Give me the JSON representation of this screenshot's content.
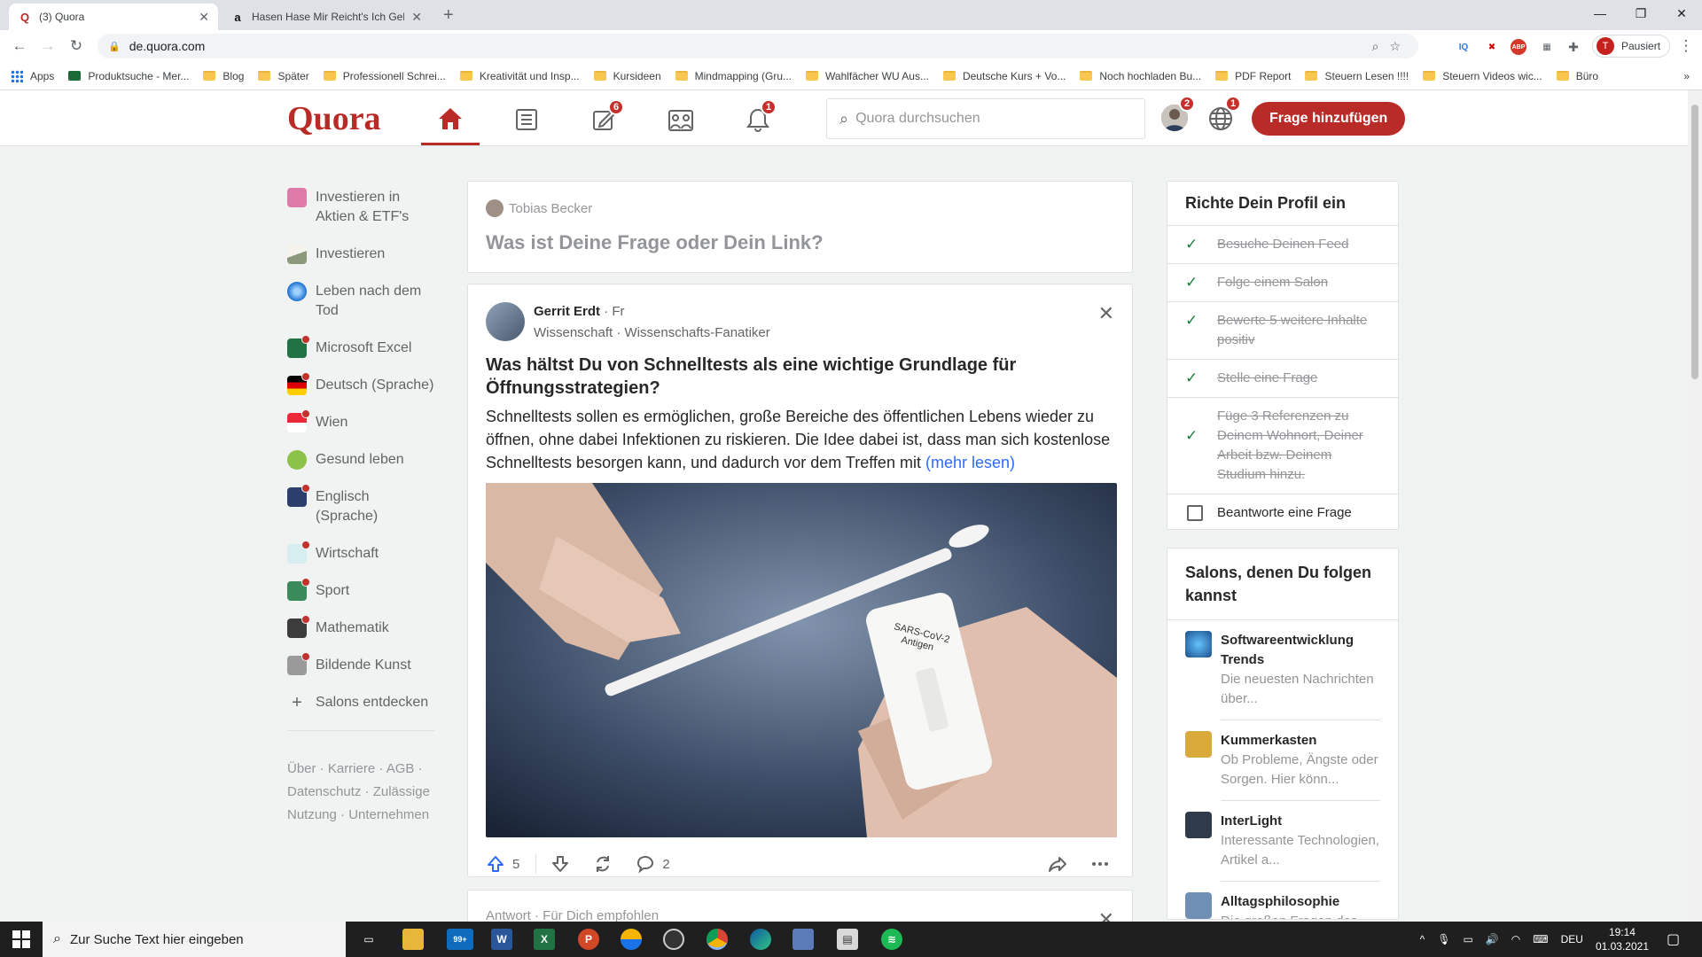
{
  "browser": {
    "tabs": [
      {
        "favicon": "Q",
        "title": "(3) Quora",
        "active": true
      },
      {
        "favicon": "a",
        "title": "Hasen Hase Mir Reicht's Ich Geh",
        "active": false
      }
    ],
    "url": "de.quora.com",
    "profile_initial": "T",
    "profile_label": "Pausiert",
    "bookmarks": [
      "Apps",
      "Produktsuche - Mer...",
      "Blog",
      "Später",
      "Professionell Schrei...",
      "Kreativität und Insp...",
      "Kursideen",
      "Mindmapping (Gru...",
      "Wahlfächer WU Aus...",
      "Deutsche Kurs + Vo...",
      "Noch hochladen Bu...",
      "PDF Report",
      "Steuern Lesen !!!!",
      "Steuern Videos wic...",
      "Büro"
    ],
    "bookmarks_more": "»"
  },
  "header": {
    "logo": "Quora",
    "badges": {
      "answer": "6",
      "notifications": "1",
      "profile": "2",
      "language": "1"
    },
    "search_placeholder": "Quora durchsuchen",
    "add_question": "Frage hinzufügen"
  },
  "sidebar": {
    "items": [
      {
        "label": "Investieren in Aktien & ETF's",
        "color": "#e07aa8",
        "dot": false
      },
      {
        "label": "Investieren",
        "color": "#d7d7c8",
        "dot": false
      },
      {
        "label": "Leben nach dem Tod",
        "color": "#1c6fd1",
        "dot": false
      },
      {
        "label": "Microsoft Excel",
        "color": "#217346",
        "dot": true
      },
      {
        "label": "Deutsch (Sprache)",
        "color": "#dd0000",
        "dot": true
      },
      {
        "label": "Wien",
        "color": "#ed2939",
        "dot": true
      },
      {
        "label": "Gesund leben",
        "color": "#8bc34a",
        "dot": false
      },
      {
        "label": "Englisch (Sprache)",
        "color": "#2c3e6b",
        "dot": true
      },
      {
        "label": "Wirtschaft",
        "color": "#7fc6c9",
        "dot": true
      },
      {
        "label": "Sport",
        "color": "#3b8b5a",
        "dot": true
      },
      {
        "label": "Mathematik",
        "color": "#3c3c3c",
        "dot": true
      },
      {
        "label": "Bildende Kunst",
        "color": "#9a9a9a",
        "dot": true
      }
    ],
    "discover": "Salons entdecken",
    "footer": "Über · Karriere · AGB · Datenschutz · Zulässige Nutzung · Unternehmen"
  },
  "ask_box": {
    "user": "Tobias Becker",
    "prompt": "Was ist Deine Frage oder Dein Link?"
  },
  "post": {
    "author": "Gerrit Erdt",
    "follow": " · Fr",
    "meta": "Wissenschaft · Wissenschafts-Fanatiker",
    "title": "Was hältst Du von Schnelltests als eine wichtige Grundlage für Öffnungsstrategien?",
    "body": "Schnelltests sollen es ermöglichen, große Bereiche des öffentlichen Lebens wieder zu öffnen, ohne dabei Infektionen zu riskieren. Die Idee dabei ist, dass man sich kostenlose Schnelltests besorgen kann, und dadurch vor dem Treffen mit",
    "more": "(mehr lesen)",
    "test_label_1": "SARS-CoV-2",
    "test_label_2": "Antigen",
    "upvotes": "5",
    "comments": "2"
  },
  "next_card": {
    "label": "Antwort · Für Dich empfohlen"
  },
  "profile_setup": {
    "title": "Richte Dein Profil ein",
    "items": [
      {
        "label": "Besuche Deinen Feed",
        "done": true
      },
      {
        "label": "Folge einem Salon",
        "done": true
      },
      {
        "label": "Bewerte 5 weitere Inhalte positiv",
        "done": true
      },
      {
        "label": "Stelle eine Frage",
        "done": true
      },
      {
        "label": "Füge 3 Referenzen zu Deinem Wohnort, Deiner Arbeit bzw. Deinem Studium hinzu.",
        "done": true
      },
      {
        "label": "Beantworte eine Frage",
        "done": false
      }
    ]
  },
  "salons": {
    "title": "Salons, denen Du folgen kannst",
    "items": [
      {
        "name": "Softwareentwicklung Trends",
        "desc": "Die neuesten Nachrichten über...",
        "color": "#1c4f8a"
      },
      {
        "name": "Kummerkasten",
        "desc": "Ob Probleme, Ängste oder Sorgen. Hier könn...",
        "color": "#d9a93a"
      },
      {
        "name": "InterLight",
        "desc": "Interessante Technologien, Artikel a...",
        "color": "#2f3b4a"
      },
      {
        "name": "Alltagsphilosophie",
        "desc": "Die großen Fragen des...",
        "color": "#6f8fb5"
      }
    ]
  },
  "taskbar": {
    "search_placeholder": "Zur Suche Text hier eingeben",
    "mail_badge": "99+",
    "lang": "DEU",
    "time": "19:14",
    "date": "01.03.2021"
  }
}
